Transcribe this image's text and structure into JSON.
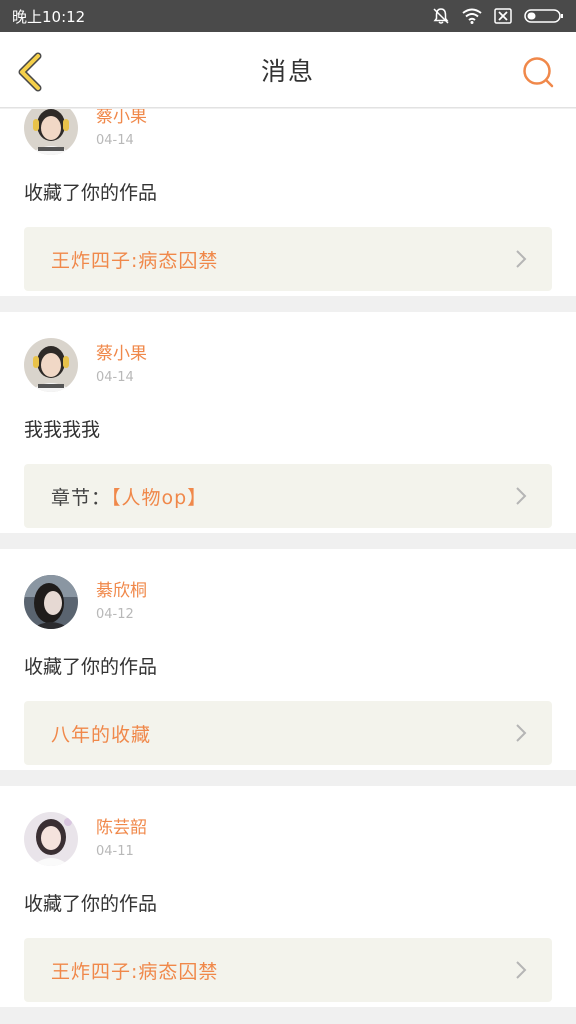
{
  "status_bar": {
    "time": "晚上10:12",
    "icons": [
      "bell-off-icon",
      "wifi-icon",
      "sim-off-icon",
      "battery-icon"
    ]
  },
  "header": {
    "title": "消息",
    "back_icon": "chevron-left-icon",
    "search_icon": "search-icon"
  },
  "colors": {
    "accent": "#f0884a",
    "back_icon": "#f5d04a",
    "date": "#b8b8b8",
    "link_bg": "#f3f3ec"
  },
  "messages": [
    {
      "username": "蔡小果",
      "date": "04-14",
      "action": "收藏了你的作品",
      "link_prefix": "",
      "link_text": "王炸四子:病态囚禁"
    },
    {
      "username": "蔡小果",
      "date": "04-14",
      "action": "我我我我",
      "link_prefix": "章节：",
      "link_text": "【人物op】"
    },
    {
      "username": "綦欣桐",
      "date": "04-12",
      "action": "收藏了你的作品",
      "link_prefix": "",
      "link_text": "八年的收藏"
    },
    {
      "username": "陈芸韶",
      "date": "04-11",
      "action": "收藏了你的作品",
      "link_prefix": "",
      "link_text": "王炸四子:病态囚禁"
    }
  ]
}
